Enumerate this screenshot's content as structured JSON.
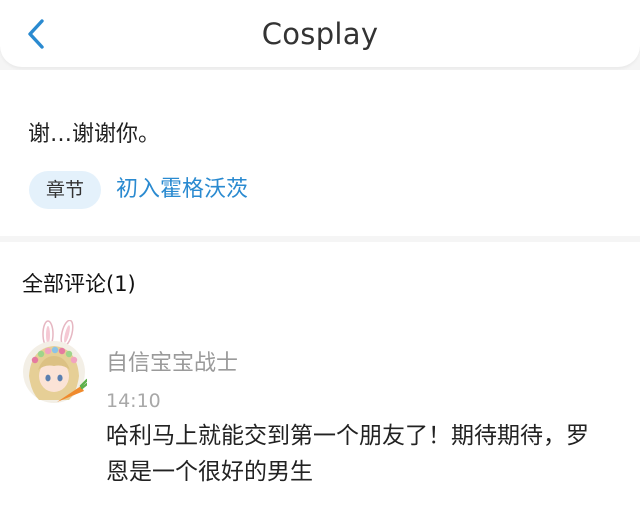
{
  "header": {
    "title": "Cosplay",
    "back_icon": "chevron-left-icon",
    "accent_color": "#2a8ad0"
  },
  "post": {
    "text": "谢…谢谢你。",
    "chapter_tag": "章节",
    "chapter_link": "初入霍格沃茨"
  },
  "comments": {
    "heading": "全部评论(1)",
    "items": [
      {
        "avatar_icon": "bunny-ear-avatar",
        "username": "自信宝宝战士",
        "time": "14:10",
        "text": "哈利马上就能交到第一个朋友了！期待期待，罗恩是一个很好的男生"
      }
    ]
  }
}
